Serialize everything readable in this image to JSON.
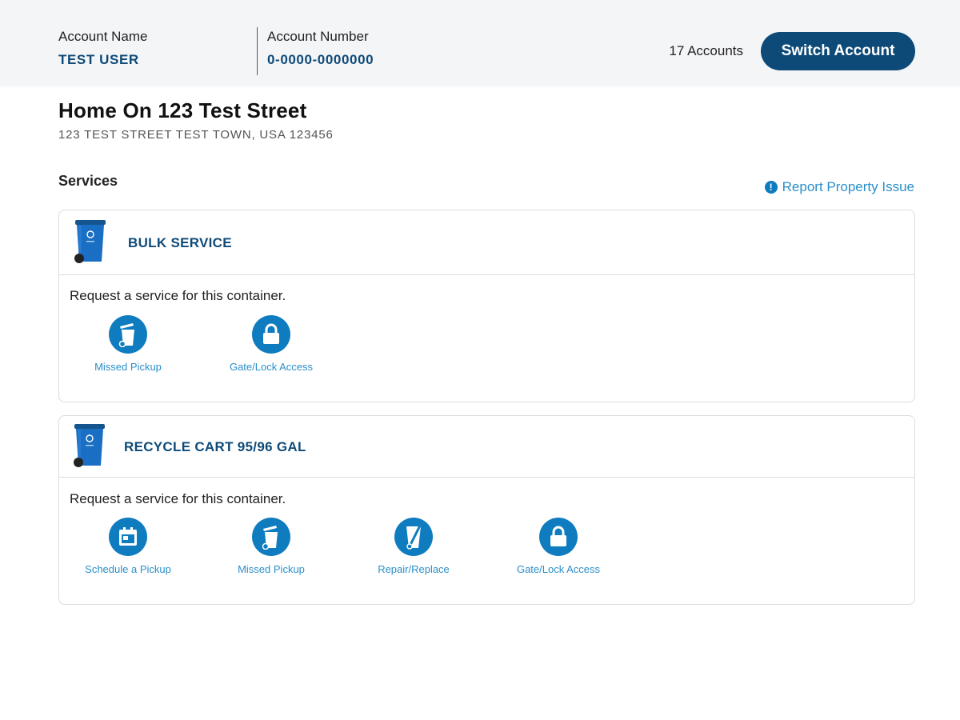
{
  "account": {
    "name_label": "Account Name",
    "name_value": "TEST USER",
    "number_label": "Account Number",
    "number_value": "0-0000-0000000",
    "accounts_count": "17 Accounts",
    "switch_button": "Switch Account"
  },
  "property": {
    "title": "Home On 123 Test Street",
    "address": "123 TEST STREET TEST TOWN, USA 123456"
  },
  "services": {
    "heading": "Services",
    "report_link": "Report Property Issue",
    "report_icon": "!",
    "cards": [
      {
        "title": "BULK SERVICE",
        "prompt": "Request a service for this container.",
        "actions": [
          {
            "label": "Missed Pickup",
            "icon": "missed-pickup-icon"
          },
          {
            "label": "Gate/Lock Access",
            "icon": "lock-icon"
          }
        ]
      },
      {
        "title": "RECYCLE CART 95/96 GAL",
        "prompt": "Request a service for this container.",
        "actions": [
          {
            "label": "Schedule a Pickup",
            "icon": "calendar-icon"
          },
          {
            "label": "Missed Pickup",
            "icon": "missed-pickup-icon"
          },
          {
            "label": "Repair/Replace",
            "icon": "repair-replace-icon"
          },
          {
            "label": "Gate/Lock Access",
            "icon": "lock-icon"
          }
        ]
      }
    ]
  },
  "colors": {
    "brand_navy": "#0e4a78",
    "action_blue": "#0e7cbf",
    "link_blue": "#2a8fc9",
    "cart_blue": "#1a6fc4"
  }
}
